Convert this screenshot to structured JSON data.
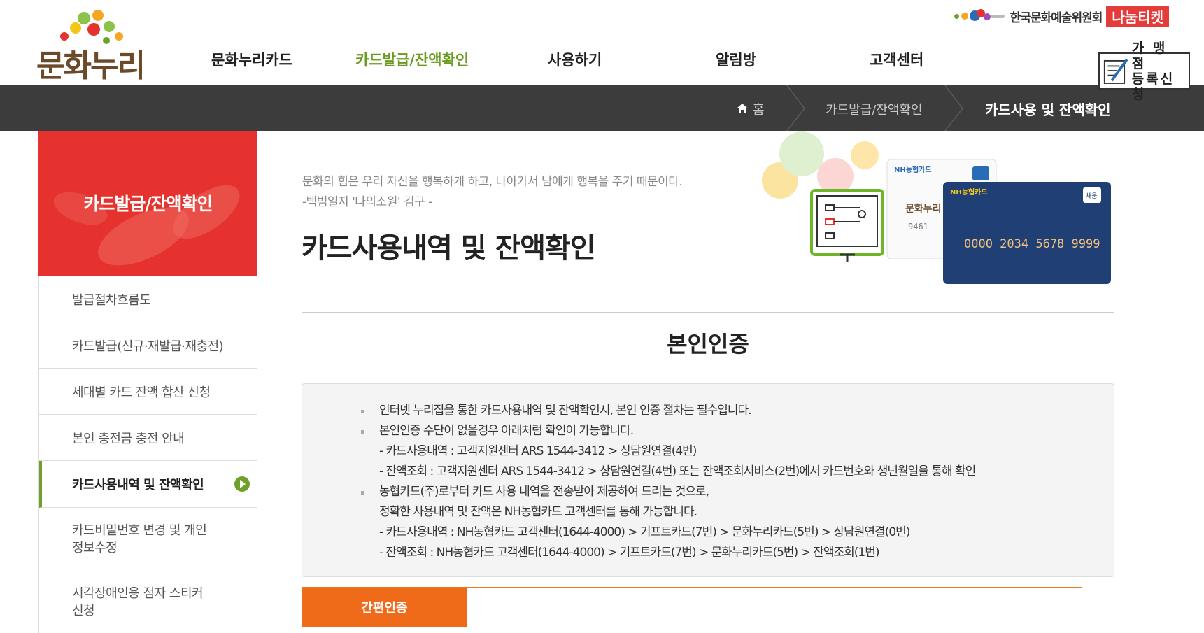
{
  "header": {
    "logo_text": "문화누리",
    "nav": [
      "문화누리카드",
      "카드발급/잔액확인",
      "사용하기",
      "알림방",
      "고객센터"
    ],
    "arts_council": "한국문화예술위원회",
    "ticket_label": "나눔티켓",
    "store_register": [
      "가 맹 점",
      "등록신청"
    ]
  },
  "breadcrumb": {
    "home": "홈",
    "parent": "카드발급/잔액확인",
    "current": "카드사용 및 잔액확인"
  },
  "sidebar": {
    "title": "카드발급/잔액확인",
    "items": [
      {
        "label": "발급절차흐름도"
      },
      {
        "label": "카드발급(신규·재발급·재충전)"
      },
      {
        "label": "세대별 카드 잔액 합산 신청"
      },
      {
        "label": "본인 충전금 충전 안내"
      },
      {
        "label": "카드사용내역 및 잔액확인"
      },
      {
        "label1": "카드비밀번호 변경 및 개인",
        "label2": "정보수정"
      },
      {
        "label1": "시각장애인용 점자 스티커",
        "label2": "신청"
      }
    ]
  },
  "main": {
    "quote1": "문화의 힘은 우리 자신을 행복하게 하고, 나아가서 남에게 행복을 주기 때문이다.",
    "quote2": "-백범일지 '나의소원' 김구 -",
    "title": "카드사용내역 및 잔액확인",
    "hero": {
      "card_brand": "NH농협카드",
      "card_number": "0000 2034 5678 9999",
      "card_badge": "채움",
      "card_logo_text": "문화누리",
      "card_back_number": "9461"
    },
    "section_title": "본인인증",
    "info": [
      "인터넷 누리집을 통한 카드사용내역 및 잔액확인시, 본인 인증 절차는 필수입니다.",
      "본인인증 수단이 없을경우 아래처럼 확인이 가능합니다.",
      "- 카드사용내역 : 고객지원센터 ARS 1544-3412 > 상담원연결(4번)",
      "- 잔액조회 : 고객지원센터 ARS 1544-3412 > 상담원연결(4번) 또는 잔액조회서비스(2번)에서 카드번호와 생년월일을 통해 확인",
      "농협카드(주)로부터 카드 사용 내역을 전송받아 제공하여 드리는 것으로,",
      "정확한 사용내역 및 잔액은 NH농협카드 고객센터를 통해 가능합니다.",
      "- 카드사용내역 : NH농협카드 고객센터(1644-4000) > 기프트카드(7번) > 문화누리카드(5번) > 상담원연결(0번)",
      "- 잔액조회 : NH농협카드 고객센터(1644-4000) > 기프트카드(7번) > 문화누리카드(5번) > 잔액조회(1번)"
    ],
    "auth_tab": "간편인증"
  }
}
